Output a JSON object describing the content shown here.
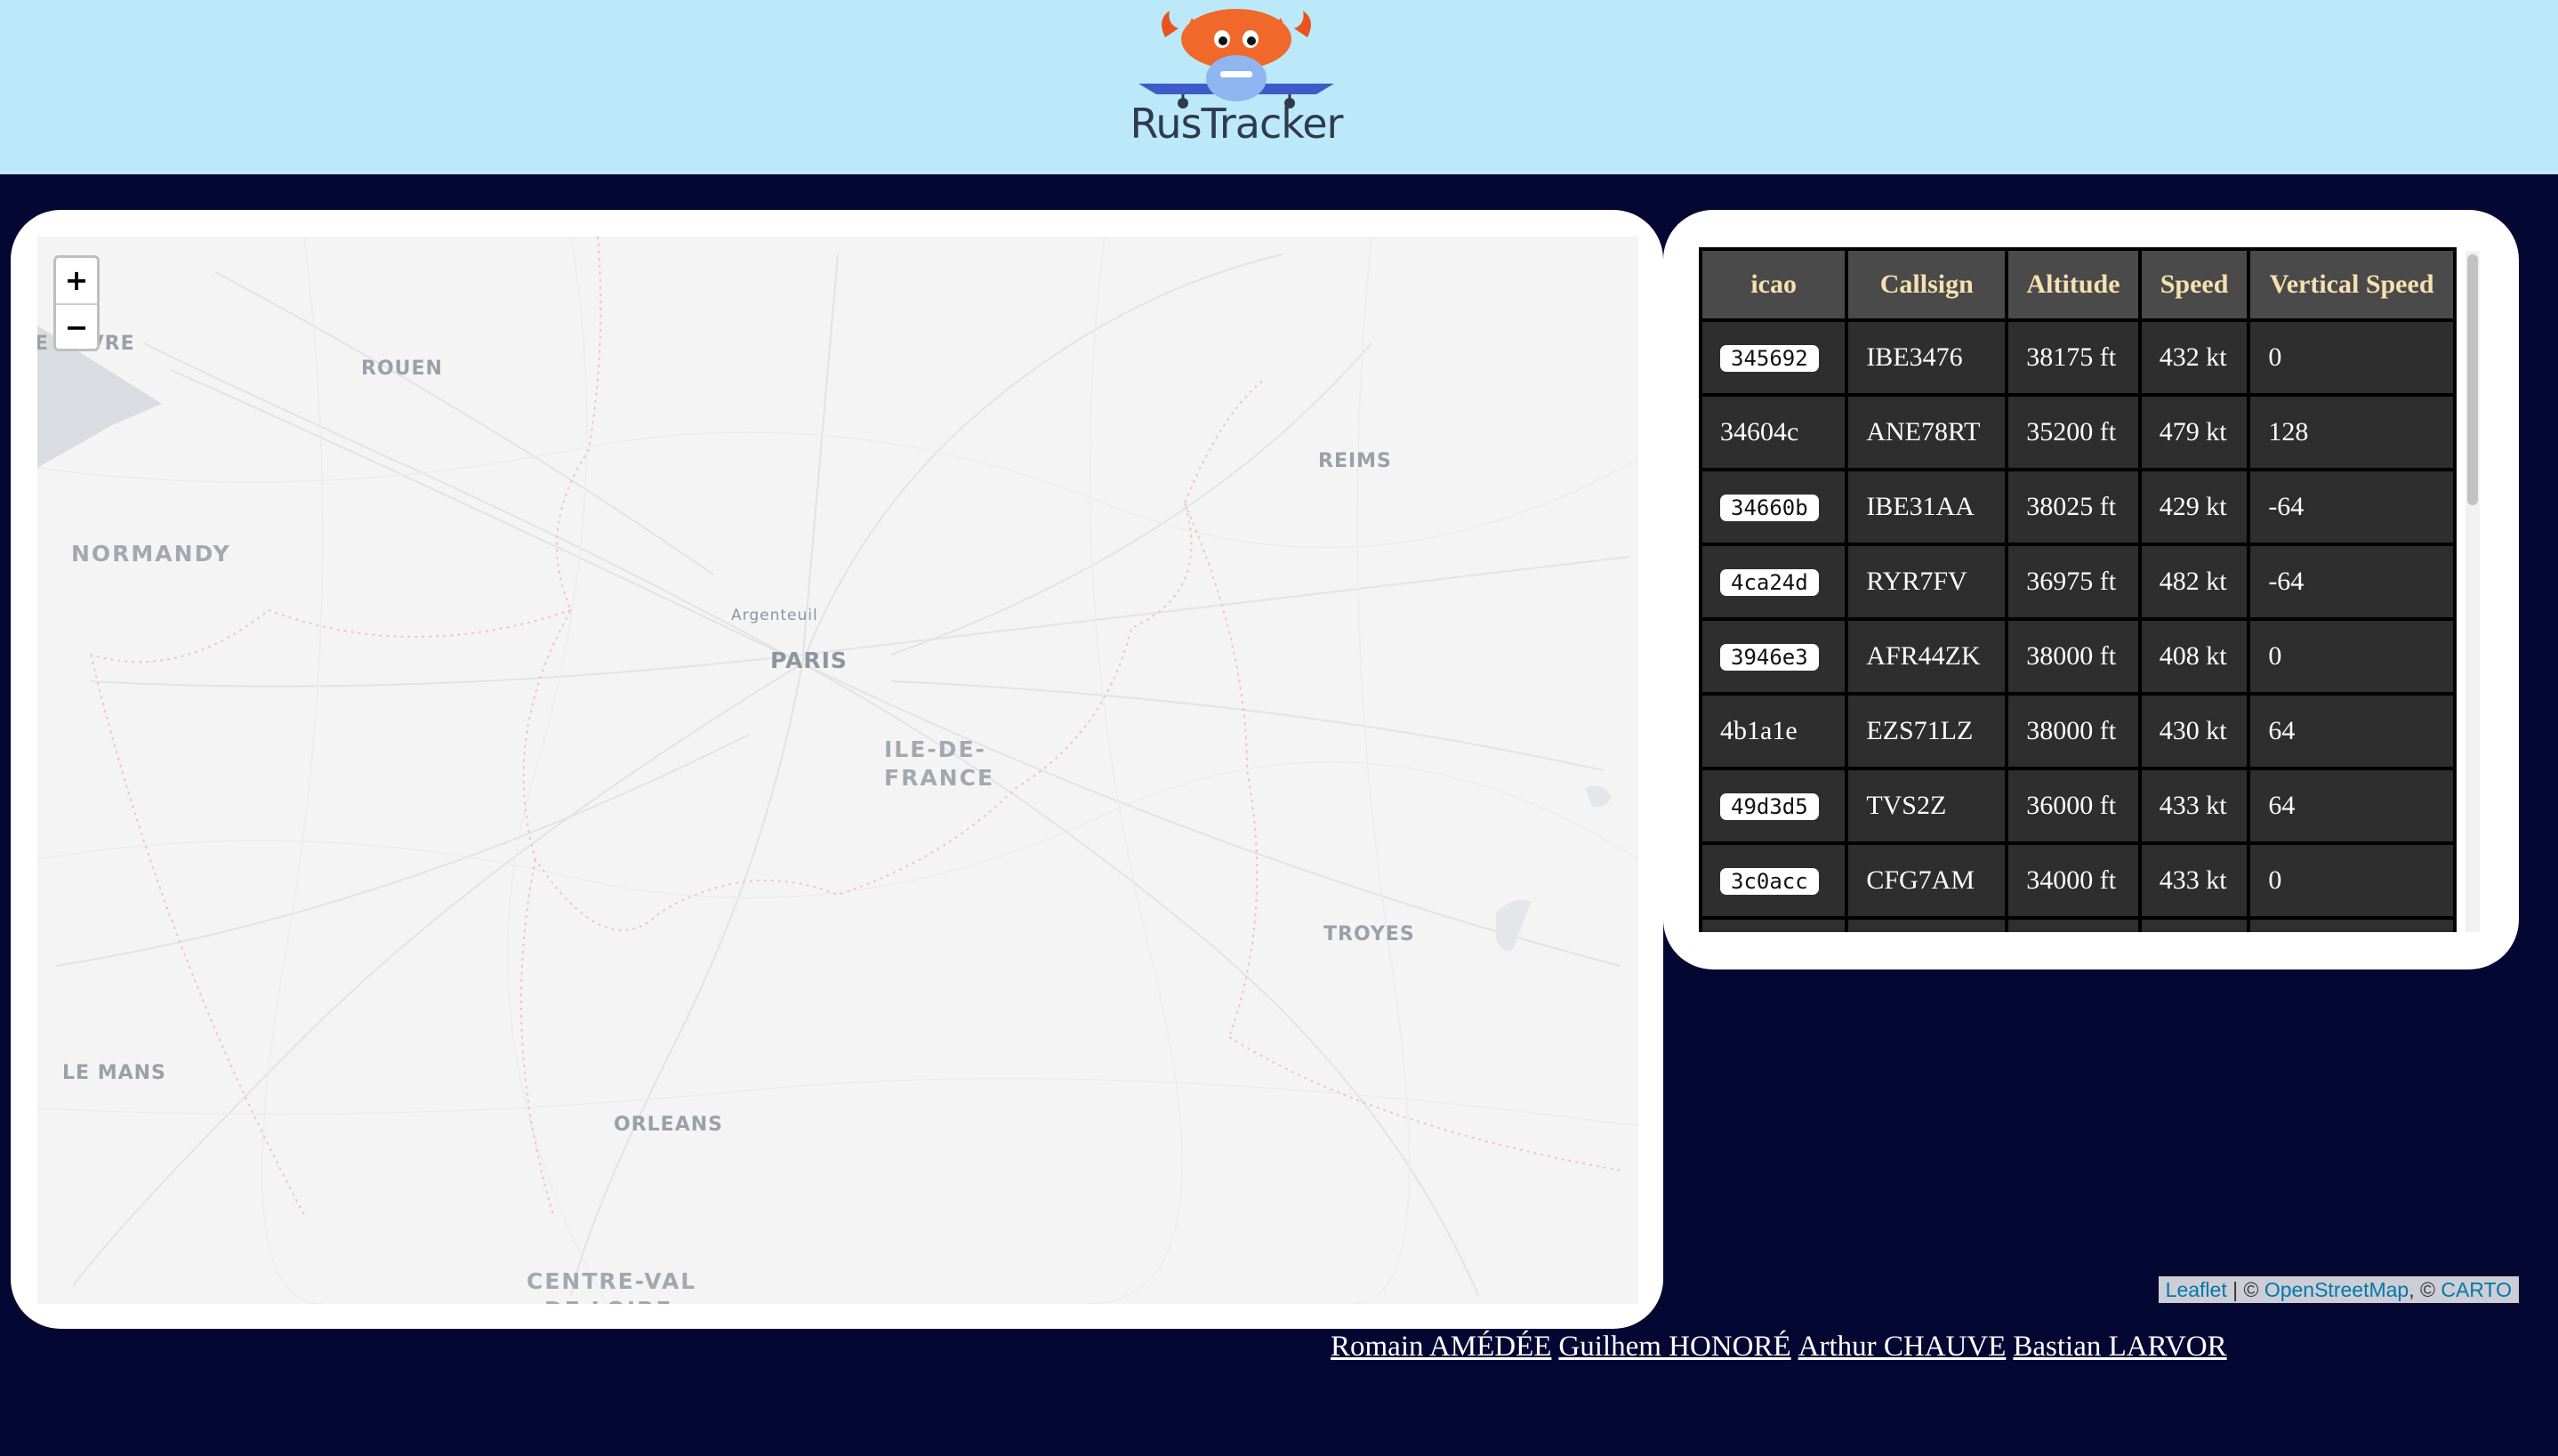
{
  "app": {
    "logo_text": "RusTracker"
  },
  "map": {
    "zoom_in_label": "+",
    "zoom_out_label": "−",
    "labels": {
      "havre": "LE HAVRE",
      "rouen": "ROUEN",
      "reims": "REIMS",
      "normandy": "NORMANDY",
      "argenteuil": "Argenteuil",
      "paris": "PARIS",
      "idf_1": "ILE-DE-",
      "idf_2": "FRANCE",
      "troyes": "TROYES",
      "le_mans": "LE MANS",
      "orleans": "ORLEANS",
      "cvl_1": "CENTRE-VAL",
      "cvl_2": "DE LOIRE"
    },
    "attribution": {
      "leaflet": "Leaflet",
      "sep1": " | © ",
      "osm": "OpenStreetMap",
      "sep2": ", © ",
      "carto": "CARTO"
    }
  },
  "flights_table": {
    "headers": {
      "icao": "icao",
      "callsign": "Callsign",
      "altitude": "Altitude",
      "speed": "Speed",
      "vertical_speed": "Vertical Speed"
    },
    "rows": [
      {
        "icao": "345692",
        "icao_style": "chip",
        "callsign": "IBE3476",
        "altitude": "38175 ft",
        "speed": "432 kt",
        "vertical_speed": "0"
      },
      {
        "icao": "34604c",
        "icao_style": "plain",
        "callsign": "ANE78RT",
        "altitude": "35200 ft",
        "speed": "479 kt",
        "vertical_speed": "128"
      },
      {
        "icao": "34660b",
        "icao_style": "chip",
        "callsign": "IBE31AA",
        "altitude": "38025 ft",
        "speed": "429 kt",
        "vertical_speed": "-64"
      },
      {
        "icao": "4ca24d",
        "icao_style": "chip",
        "callsign": "RYR7FV",
        "altitude": "36975 ft",
        "speed": "482 kt",
        "vertical_speed": "-64"
      },
      {
        "icao": "3946e3",
        "icao_style": "chip",
        "callsign": "AFR44ZK",
        "altitude": "38000 ft",
        "speed": "408 kt",
        "vertical_speed": "0"
      },
      {
        "icao": "4b1a1e",
        "icao_style": "plain",
        "callsign": "EZS71LZ",
        "altitude": "38000 ft",
        "speed": "430 kt",
        "vertical_speed": "64"
      },
      {
        "icao": "49d3d5",
        "icao_style": "chip",
        "callsign": "TVS2Z",
        "altitude": "36000 ft",
        "speed": "433 kt",
        "vertical_speed": "64"
      },
      {
        "icao": "3c0acc",
        "icao_style": "chip",
        "callsign": "CFG7AM",
        "altitude": "34000 ft",
        "speed": "433 kt",
        "vertical_speed": "0"
      },
      {
        "icao": "",
        "icao_style": "plain",
        "callsign": "",
        "altitude": "",
        "speed": "",
        "vertical_speed": ""
      }
    ]
  },
  "footer": {
    "authors": [
      "Romain AMÉDÉE",
      "Guilhem HONORÉ",
      "Arthur CHAUVE",
      "Bastian LARVOR"
    ]
  },
  "colors": {
    "header_bg": "#bce9f9",
    "page_bg": "#050733",
    "table_header_text": "#f6e0b0",
    "table_cell_bg": "#2e2e2e",
    "link": "#0078a8"
  },
  "icons": {
    "logo": "crab-plane-logo",
    "zoom_in": "plus-icon",
    "zoom_out": "minus-icon"
  }
}
